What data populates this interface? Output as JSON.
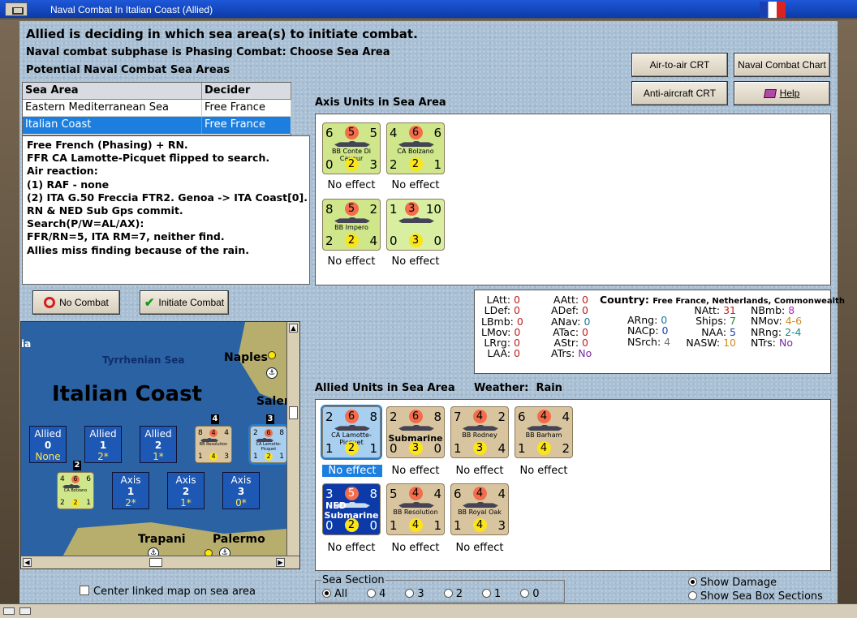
{
  "window": {
    "title": "Naval Combat In Italian Coast (Allied)"
  },
  "header": {
    "line1": "Allied is deciding in which sea area(s) to initiate combat.",
    "line2": "Naval combat subphase is Phasing Combat: Choose Sea Area",
    "line3": "Potential Naval Combat Sea Areas"
  },
  "buttons": {
    "air_to_air": "Air-to-air CRT",
    "naval_chart": "Naval Combat Chart",
    "anti_aircraft": "Anti-aircraft CRT",
    "help": "Help",
    "no_combat": "No Combat",
    "initiate": "Initiate Combat"
  },
  "sea_table": {
    "headers": [
      "Sea Area",
      "Decider"
    ],
    "rows": [
      [
        "Eastern Mediterranean Sea",
        "Free France"
      ],
      [
        "Italian Coast",
        "Free France"
      ]
    ],
    "selected_index": 1
  },
  "log": [
    "Free French (Phasing) + RN.",
    "FFR CA Lamotte-Picquet flipped to search.",
    "Air reaction:",
    "(1) RAF - none",
    "(2) ITA G.50 Freccia FTR2.  Genoa -> ITA Coast[0].",
    "RN & NED Sub Gps commit.",
    "Search(P/W=AL/AX):",
    "FFR/RN=5, ITA RM=7, neither find.",
    "Allies miss finding because of the rain."
  ],
  "axis": {
    "title": "Axis Units in Sea Area",
    "units": [
      {
        "tl": "6",
        "tc": "5",
        "tr": "5",
        "bl": "0",
        "bc": "2",
        "br": "3",
        "name": "BB Conte Di Cavour",
        "effect": "No effect"
      },
      {
        "tl": "4",
        "tc": "6",
        "tr": "6",
        "bl": "2",
        "bc": "2",
        "br": "1",
        "name": "CA Bolzano",
        "effect": "No effect"
      },
      {
        "tl": "8",
        "tc": "5",
        "tr": "2",
        "bl": "2",
        "bc": "2",
        "br": "4",
        "name": "BB Impero",
        "effect": "No effect"
      },
      {
        "tl": "1",
        "tc": "3",
        "tr": "10",
        "bl": "0",
        "bc": "3",
        "br": "0",
        "name": "",
        "effect": "No effect"
      }
    ]
  },
  "stats": {
    "col1": [
      [
        "LAtt:",
        "0"
      ],
      [
        "LDef:",
        "0"
      ],
      [
        "LBmb:",
        "0"
      ],
      [
        "LMov:",
        "0"
      ],
      [
        "LRrg:",
        "0"
      ],
      [
        "LAA:",
        "0"
      ]
    ],
    "col2": [
      [
        "AAtt:",
        "0"
      ],
      [
        "ADef:",
        "0"
      ],
      [
        "ANav:",
        "0"
      ],
      [
        "ATac:",
        "0"
      ],
      [
        "AStr:",
        "0"
      ],
      [
        "ATrs:",
        "No"
      ]
    ],
    "country_label": "Country:",
    "country": "Free France, Netherlands, Commonwealth",
    "col3": [
      [
        "ARng:",
        "0"
      ],
      [
        "NACp:",
        "0"
      ],
      [
        "NSrch:",
        "4"
      ]
    ],
    "col4": [
      [
        "NAtt:",
        "31"
      ],
      [
        "Ships:",
        "7"
      ],
      [
        "NAA:",
        "5"
      ],
      [
        "NASW:",
        "10"
      ]
    ],
    "col5": [
      [
        "NBmb:",
        "8"
      ],
      [
        "NMov:",
        "4-6"
      ],
      [
        "NRng:",
        "2-4"
      ],
      [
        "NTrs:",
        "No"
      ]
    ]
  },
  "allied": {
    "title": "Allied Units in Sea Area",
    "weather_label": "Weather:",
    "weather": "Rain",
    "units": [
      {
        "tl": "2",
        "tc": "6",
        "tr": "8",
        "bl": "1",
        "bc": "2",
        "br": "1",
        "name": "CA Lamotte-Picquet",
        "effect": "No effect",
        "style": "selected"
      },
      {
        "tl": "2",
        "tc": "6",
        "tr": "8",
        "bl": "0",
        "bc": "3",
        "br": "0",
        "name": "Submarine",
        "effect": "No effect",
        "style": "tan"
      },
      {
        "tl": "7",
        "tc": "4",
        "tr": "2",
        "bl": "1",
        "bc": "3",
        "br": "4",
        "name": "BB Rodney",
        "effect": "No effect",
        "style": "tan"
      },
      {
        "tl": "6",
        "tc": "4",
        "tr": "4",
        "bl": "1",
        "bc": "4",
        "br": "2",
        "name": "BB Barham",
        "effect": "No effect",
        "style": "tan"
      },
      {
        "tl": "3",
        "tc": "5",
        "tr": "8",
        "bl": "0",
        "bc": "2",
        "br": "0",
        "name": "Submarine",
        "effect": "No effect",
        "style": "blue",
        "tag": "NED"
      },
      {
        "tl": "5",
        "tc": "4",
        "tr": "4",
        "bl": "1",
        "bc": "4",
        "br": "1",
        "name": "BB Resolution",
        "effect": "No effect",
        "style": "tan"
      },
      {
        "tl": "6",
        "tc": "4",
        "tr": "4",
        "bl": "1",
        "bc": "4",
        "br": "3",
        "name": "BB Royal Oak",
        "effect": "No effect",
        "style": "tan"
      }
    ]
  },
  "map": {
    "sea_name": "Tyrrhenian Sea",
    "area_name": "Italian Coast",
    "naples": "Naples",
    "salerno": "Salern",
    "trapani": "Trapani",
    "palermo": "Palermo",
    "left_edge": "ia",
    "allied_boxes": [
      {
        "label": "Allied",
        "num": "0",
        "val": "None"
      },
      {
        "label": "Allied",
        "num": "1",
        "val": "2*"
      },
      {
        "label": "Allied",
        "num": "2",
        "val": "1*"
      }
    ],
    "axis_boxes": [
      {
        "label": "Axis",
        "num": "1",
        "val": "2*"
      },
      {
        "label": "Axis",
        "num": "2",
        "val": "1*"
      },
      {
        "label": "Axis",
        "num": "3",
        "val": "0*"
      }
    ],
    "stack_badges": [
      "4",
      "3",
      "2"
    ],
    "map_counters": [
      {
        "tl": "8",
        "tc": "4",
        "tr": "4",
        "bl": "1",
        "bc": "4",
        "br": "3",
        "name": "BB Resolution"
      },
      {
        "tl": "2",
        "tc": "6",
        "tr": "8",
        "bl": "1",
        "bc": "2",
        "br": "1",
        "name": "CA Lamotte-Picquet"
      },
      {
        "tl": "4",
        "tc": "6",
        "tr": "6",
        "bl": "2",
        "bc": "2",
        "br": "1",
        "name": "CA Bolzano"
      }
    ]
  },
  "center_checkbox": "Center linked map on sea area",
  "sea_section": {
    "title": "Sea Section",
    "options": [
      "All",
      "4",
      "3",
      "2",
      "1",
      "0"
    ],
    "selected": "All"
  },
  "display": {
    "show_damage": "Show Damage",
    "show_sections": "Show Sea Box Sections",
    "selected": "Show Damage"
  },
  "colors": {
    "title_bar": "#1e58d8",
    "panel_bg": "#a9bfd3",
    "counter_axis": "#cfe68a",
    "counter_allied": "#d8c5a0",
    "counter_selected": "#a8cff0",
    "counter_ned": "#0c3aa8",
    "red_circle": "#f36c4c",
    "yellow_circle": "#fbe41a"
  }
}
